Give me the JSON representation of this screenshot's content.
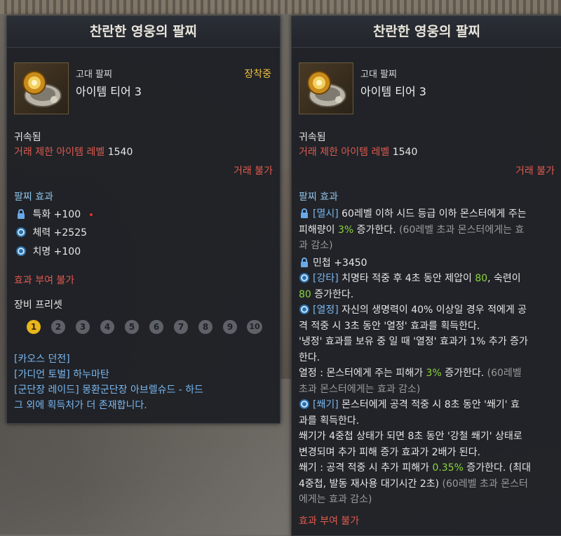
{
  "colors": {
    "accent_gold": "#f2c23c",
    "restricted_red": "#e05a4e",
    "section_blue": "#8fc4e9",
    "value_green": "#8cd43c"
  },
  "left": {
    "title": "찬란한 영웅의 팔찌",
    "item": {
      "grade": "고대 팔찌",
      "tier": "아이템 티어 3",
      "equipped": "장착중",
      "icon": "bracelet-icon"
    },
    "bound": "귀속됨",
    "trade_label": "거래 제한 아이템 레벨",
    "trade_value": "1540",
    "no_trade": "거래 불가",
    "effect_title": "팔찌 효과",
    "effects": [
      {
        "icon": "lock-icon",
        "text": "특화 +100"
      },
      {
        "icon": "swirl-icon",
        "text": "체력 +2525"
      },
      {
        "icon": "swirl-icon",
        "text": "치명 +100"
      }
    ],
    "no_enchant": "효과 부여 불가",
    "preset_title": "장비 프리셋",
    "presets": [
      "1",
      "2",
      "3",
      "4",
      "5",
      "6",
      "7",
      "8",
      "9",
      "10"
    ],
    "active_preset": "1",
    "sources": [
      "[카오스 던전]",
      "[가디언 토벌] 하누마탄",
      "[군단장 레이드] 몽환군단장 아브렐슈드 - 하드",
      "그 외에 획득처가 더 존재합니다."
    ]
  },
  "right": {
    "title": "찬란한 영웅의 팔찌",
    "item": {
      "grade": "고대 팔찌",
      "tier": "아이템 티어 3",
      "icon": "bracelet-icon"
    },
    "bound": "귀속됨",
    "trade_label": "거래 제한 아이템 레벨",
    "trade_value": "1540",
    "no_trade": "거래 불가",
    "effect_title": "팔찌 효과",
    "e1_tag": "[멸시]",
    "e1_a": " 60레벨 이하 시드 등급 이하 몬스터에게 주는",
    "e1_b": "피해량이 ",
    "e1_b_val": "3%",
    "e1_b_rest": " 증가한다.",
    "e1_b_note": " (60레벨 초과 몬스터에게는 효",
    "e1_c_note": "과 감소)",
    "e2": "민첩 +3450",
    "e3_tag": "[강타]",
    "e3_a": " 치명타 적중 후 4초 동안 제압이 ",
    "e3_a_val": "80",
    "e3_a_rest": ", 숙련이",
    "e3_b_val": "80",
    "e3_b_rest": " 증가한다.",
    "e4_tag": "[열정]",
    "e4_a": " 자신의 생명력이 40% 이상일 경우 적에게 공",
    "e4_b": "격 적중 시 3초 동안 '열정' 효과를 획득한다.",
    "e4_c": "'냉정' 효과를 보유 중 일 때 '열정' 효과가 1% 추가 증가",
    "e4_d": "한다.",
    "e4_e": "열정 : 몬스터에게 주는 피해가 ",
    "e4_e_val": "3%",
    "e4_e_rest": " 증가한다.",
    "e4_e_note": " (60레벨",
    "e4_f_note": "초과 몬스터에게는 효과 감소)",
    "e5_tag": "[쐐기]",
    "e5_a": " 몬스터에게 공격 적중 시 8초 동안 '쐐기' 효",
    "e5_b": "과를 획득한다.",
    "e5_c": "쐐기가 4중첩 상태가 되면 8초 동안 '강철 쐐기' 상태로",
    "e5_d": "변경되며 추가 피해 증가 효과가 2배가 된다.",
    "e5_e": "쐐기 : 공격 적중 시 추가 피해가 ",
    "e5_e_val": "0.35%",
    "e5_e_rest": " 증가한다. (최대",
    "e5_f": "4중첩, 발동 재사용 대기시간 2초)",
    "e5_f_note": " (60레벨 초과 몬스터",
    "e5_g_note": "에게는 효과 감소)",
    "no_enchant": "효과 부여 불가"
  }
}
